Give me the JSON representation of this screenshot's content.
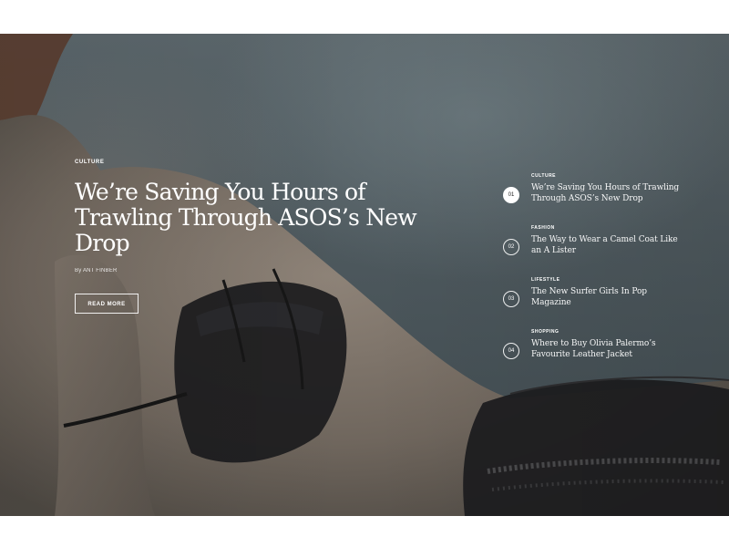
{
  "hero": {
    "featured": {
      "category": "CULTURE",
      "title": "We’re Saving You Hours of Trawling Through ASOS’s New Drop",
      "author": "By ANT FINBER",
      "cta": "READ MORE"
    },
    "articles": [
      {
        "number": "01",
        "category": "CULTURE",
        "title": "We’re Saving You Hours of Trawling Through ASOS’s New Drop",
        "active": true
      },
      {
        "number": "02",
        "category": "FASHION",
        "title": "The Way to Wear a Camel Coat Like an A Lister",
        "active": false
      },
      {
        "number": "03",
        "category": "LIFESTYLE",
        "title": "The New Surfer Girls In Pop Magazine",
        "active": false
      },
      {
        "number": "04",
        "category": "SHOPPING",
        "title": "Where to Buy Olivia Palermo’s Favourite Leather Jacket",
        "active": false
      }
    ]
  }
}
